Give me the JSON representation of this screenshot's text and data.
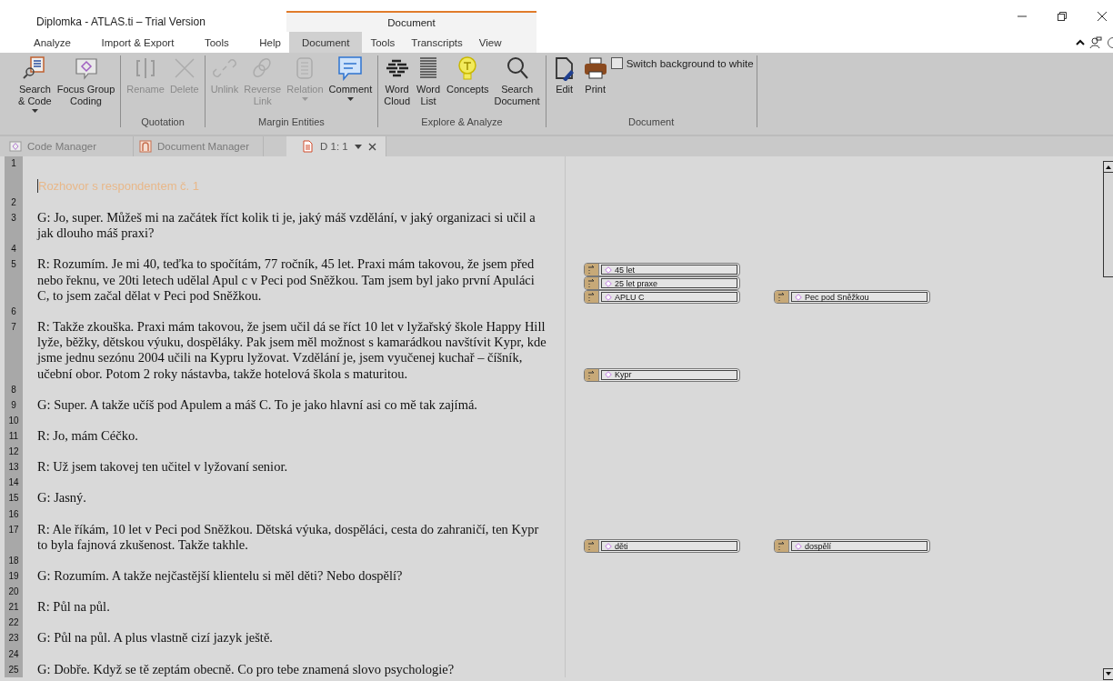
{
  "window": {
    "title": "Diplomka - ATLAS.ti – Trial Version",
    "context_group": "Document"
  },
  "menu_tabs": [
    {
      "label": "Analyze",
      "selected": false,
      "context": false
    },
    {
      "label": "Import & Export",
      "selected": false,
      "context": false
    },
    {
      "label": "Tools",
      "selected": false,
      "context": false
    },
    {
      "label": "Help",
      "selected": false,
      "context": false
    },
    {
      "label": "Document",
      "selected": true,
      "context": true
    },
    {
      "label": "Tools",
      "selected": false,
      "context": true
    },
    {
      "label": "Transcripts",
      "selected": false,
      "context": true
    },
    {
      "label": "View",
      "selected": false,
      "context": true
    }
  ],
  "ribbon": {
    "groups": [
      {
        "items": [
          {
            "kind": "button",
            "label": "Search\n& Code",
            "disabled": false,
            "dropdown": true
          },
          {
            "kind": "button",
            "label": "Focus Group\nCoding",
            "disabled": false,
            "dropdown": false
          }
        ]
      },
      {
        "label": "Quotation",
        "items": [
          {
            "kind": "button",
            "label": "Rename",
            "disabled": true,
            "dropdown": false
          },
          {
            "kind": "button",
            "label": "Delete",
            "disabled": true,
            "dropdown": false
          }
        ]
      },
      {
        "label": "Margin Entities",
        "items": [
          {
            "kind": "button",
            "label": "Unlink",
            "disabled": true,
            "dropdown": false
          },
          {
            "kind": "button",
            "label": "Reverse\nLink",
            "disabled": true,
            "dropdown": false
          },
          {
            "kind": "button",
            "label": "Relation",
            "disabled": true,
            "dropdown": true
          },
          {
            "kind": "button",
            "label": "Comment",
            "disabled": false,
            "dropdown": true
          }
        ]
      },
      {
        "label": "Explore & Analyze",
        "items": [
          {
            "kind": "button",
            "label": "Word\nCloud",
            "disabled": false,
            "dropdown": false
          },
          {
            "kind": "button",
            "label": "Word\nList",
            "disabled": false,
            "dropdown": false
          },
          {
            "kind": "button",
            "label": "Concepts",
            "disabled": false,
            "dropdown": false
          },
          {
            "kind": "button",
            "label": "Search\nDocument",
            "disabled": false,
            "dropdown": false
          }
        ]
      },
      {
        "label": "Document",
        "items": [
          {
            "kind": "button",
            "label": "Edit",
            "disabled": false,
            "dropdown": false
          },
          {
            "kind": "button",
            "label": "Print",
            "disabled": false,
            "dropdown": false
          },
          {
            "kind": "checkbox",
            "label": "Switch background to white",
            "checked": false
          }
        ]
      }
    ]
  },
  "document_tabs": [
    {
      "label": "Code Manager",
      "selected": false
    },
    {
      "label": "Document Manager",
      "selected": false
    },
    {
      "label": "D 1: 1",
      "selected": true
    }
  ],
  "document": {
    "rows": [
      {
        "number": "1",
        "kind": "title",
        "text": "Rozhovor s respondentem č. 1"
      },
      {
        "number": "2",
        "kind": "blank"
      },
      {
        "number": "3",
        "kind": "text",
        "text": "G: Jo, super. Můžeš mi na začátek říct kolik ti je, jaký máš vzdělání, v jaký organizaci si učil a jak dlouho máš praxi?"
      },
      {
        "number": "4",
        "kind": "blank"
      },
      {
        "number": "5",
        "kind": "text",
        "text": "R: Rozumím. Je mi 40, teďka to spočítám, 77 ročník, 45 let. Praxi mám takovou, že jsem před nebo řeknu, ve 20ti letech udělal Apul c v Peci pod Sněžkou. Tam jsem byl jako první Apuláci C, to jsem začal dělat v Peci pod Sněžkou.",
        "margin_columns": [
          {
            "codes": [
              {
                "label": "45 let"
              },
              {
                "label": "25 let praxe"
              },
              {
                "label": "APLU C"
              }
            ]
          },
          {
            "codes": [
              {
                "label": "Pec pod Sněžkou"
              }
            ]
          }
        ]
      },
      {
        "number": "6",
        "kind": "blank"
      },
      {
        "number": "7",
        "kind": "text",
        "text": "R: Takže zkouška. Praxi mám  takovou, že jsem učil dá se říct 10 let v lyžařský škole Happy Hill lyže, běžky, dětskou výuku, dospěláky. Pak jsem měl možnost s kamarádkou navštívit Kypr, kde jsme jednu sezónu 2004 učili na Kypru lyžovat. Vzdělání je, jsem vyučenej kuchař – číšník, učební obor. Potom 2 roky nástavba, takže hotelová škola s maturitou.",
        "margin_columns": [
          {
            "codes": [
              {
                "label": "Kypr"
              }
            ]
          }
        ]
      },
      {
        "number": "8",
        "kind": "blank"
      },
      {
        "number": "9",
        "kind": "text",
        "text": "G: Super. A takže učíš pod Apulem a máš C. To je jako hlavní asi co mě tak zajímá."
      },
      {
        "number": "10",
        "kind": "blank"
      },
      {
        "number": "11",
        "kind": "text",
        "text": "R: Jo, mám Céčko."
      },
      {
        "number": "12",
        "kind": "blank"
      },
      {
        "number": "13",
        "kind": "text",
        "text": "R: Už jsem takovej ten učitel v lyžovaní senior."
      },
      {
        "number": "14",
        "kind": "blank"
      },
      {
        "number": "15",
        "kind": "text",
        "text": "G: Jasný."
      },
      {
        "number": "16",
        "kind": "blank"
      },
      {
        "number": "17",
        "kind": "text",
        "text": "R: Ale říkám, 10 let v Peci pod Sněžkou. Dětská výuka, dospěláci, cesta do zahraničí, ten Kypr to byla fajnová zkušenost. Takže takhle.",
        "margin_columns": [
          {
            "codes": [
              {
                "label": "děti"
              }
            ]
          },
          {
            "codes": [
              {
                "label": "dospělí"
              }
            ]
          }
        ]
      },
      {
        "number": "18",
        "kind": "blank"
      },
      {
        "number": "19",
        "kind": "text",
        "text": "G: Rozumím. A takže nejčastější klientelu si měl děti? Nebo dospělí?"
      },
      {
        "number": "20",
        "kind": "blank"
      },
      {
        "number": "21",
        "kind": "text",
        "text": "R: Půl na půl."
      },
      {
        "number": "22",
        "kind": "blank"
      },
      {
        "number": "23",
        "kind": "text",
        "text": "G: Půl na půl. A plus vlastně cizí jazyk ještě."
      },
      {
        "number": "24",
        "kind": "blank"
      },
      {
        "number": "25",
        "kind": "text",
        "text": "G: Dobře. Když se tě zeptám obecně. Co pro tebe znamená slovo psychologie?"
      }
    ]
  }
}
